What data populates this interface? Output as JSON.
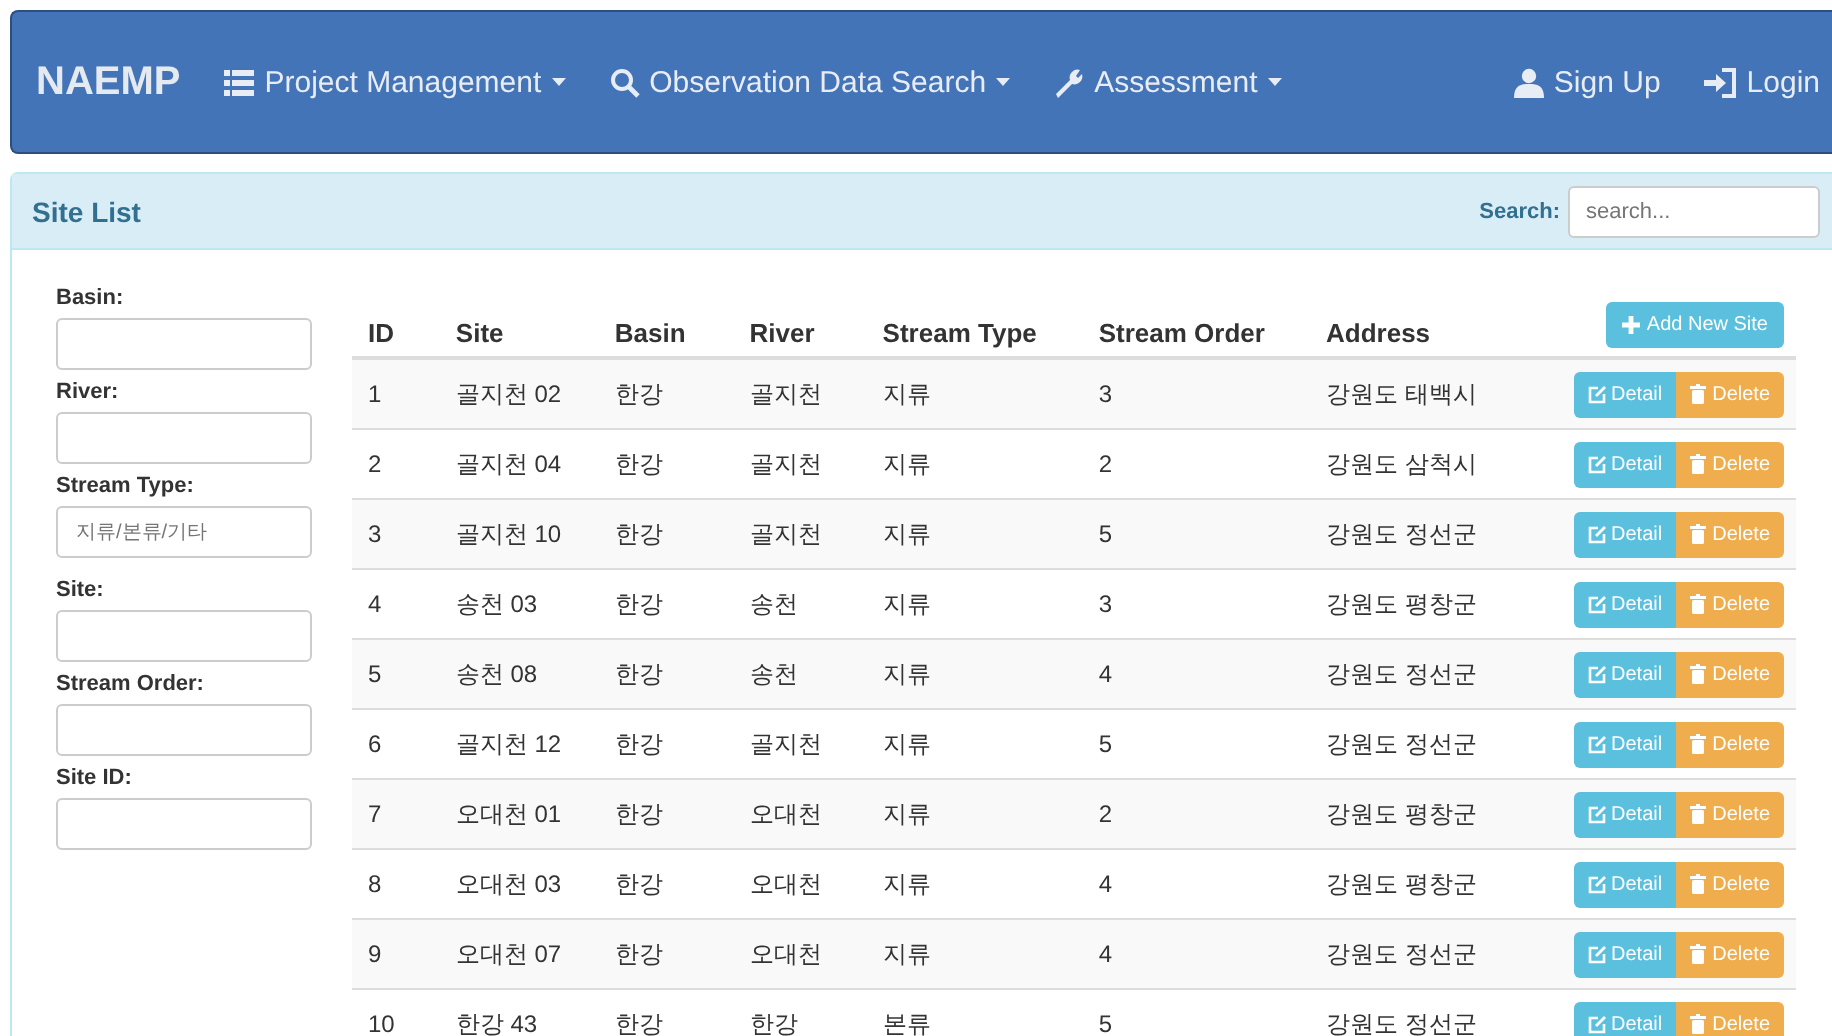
{
  "navbar": {
    "brand": "NAEMP",
    "menus": [
      {
        "label": "Project Management",
        "dropdown": true
      },
      {
        "label": "Observation Data Search",
        "dropdown": true
      },
      {
        "label": "Assessment",
        "dropdown": true
      }
    ],
    "links": [
      {
        "label": "Sign Up"
      },
      {
        "label": "Login"
      }
    ]
  },
  "panel": {
    "title": "Site List",
    "search": {
      "label": "Search:",
      "placeholder": "search..."
    }
  },
  "filters": [
    {
      "label": "Basin:"
    },
    {
      "label": "River:"
    },
    {
      "label": "Stream Type:",
      "placeholder": "지류/본류/기타"
    },
    {
      "label": "Site:"
    },
    {
      "label": "Stream Order:"
    },
    {
      "label": "Site ID:"
    }
  ],
  "table": {
    "columns": [
      "ID",
      "Site",
      "Basin",
      "River",
      "Stream Type",
      "Stream Order",
      "Address"
    ],
    "add_button": "Add New Site",
    "rows": [
      {
        "cells": [
          "1",
          "골지천 02",
          "한강",
          "골지천",
          "지류",
          "3",
          "강원도 태백시"
        ],
        "detail": "Detail",
        "delete": "Delete"
      },
      {
        "cells": [
          "2",
          "골지천 04",
          "한강",
          "골지천",
          "지류",
          "2",
          "강원도 삼척시"
        ],
        "detail": "Detail",
        "delete": "Delete"
      },
      {
        "cells": [
          "3",
          "골지천 10",
          "한강",
          "골지천",
          "지류",
          "5",
          "강원도 정선군"
        ],
        "detail": "Detail",
        "delete": "Delete"
      },
      {
        "cells": [
          "4",
          "송천 03",
          "한강",
          "송천",
          "지류",
          "3",
          "강원도 평창군"
        ],
        "detail": "Detail",
        "delete": "Delete"
      },
      {
        "cells": [
          "5",
          "송천 08",
          "한강",
          "송천",
          "지류",
          "4",
          "강원도 정선군"
        ],
        "detail": "Detail",
        "delete": "Delete"
      },
      {
        "cells": [
          "6",
          "골지천 12",
          "한강",
          "골지천",
          "지류",
          "5",
          "강원도 정선군"
        ],
        "detail": "Detail",
        "delete": "Delete"
      },
      {
        "cells": [
          "7",
          "오대천 01",
          "한강",
          "오대천",
          "지류",
          "2",
          "강원도 평창군"
        ],
        "detail": "Detail",
        "delete": "Delete"
      },
      {
        "cells": [
          "8",
          "오대천 03",
          "한강",
          "오대천",
          "지류",
          "4",
          "강원도 평창군"
        ],
        "detail": "Detail",
        "delete": "Delete"
      },
      {
        "cells": [
          "9",
          "오대천 07",
          "한강",
          "오대천",
          "지류",
          "4",
          "강원도 정선군"
        ],
        "detail": "Detail",
        "delete": "Delete"
      },
      {
        "cells": [
          "10",
          "한강 43",
          "한강",
          "한강",
          "본류",
          "5",
          "강원도 정선군"
        ],
        "detail": "Detail",
        "delete": "Delete"
      }
    ]
  }
}
